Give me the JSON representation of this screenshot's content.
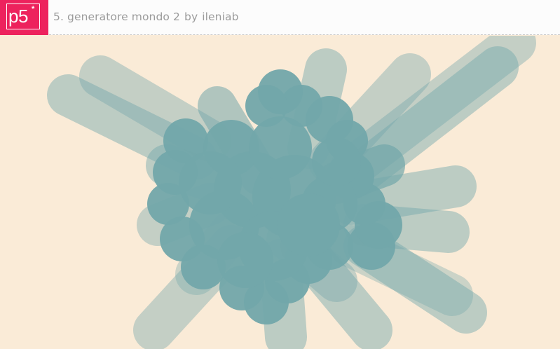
{
  "header": {
    "logo_text": "p5",
    "logo_star": "*",
    "sketch_title": "5. generatore mondo 2",
    "by_label": "by",
    "author": "ileniab"
  },
  "colors": {
    "brand": "#ed225d",
    "canvas_bg": "#faebd7",
    "blob": "#72a6aa",
    "header_bg": "#fcfcfc",
    "header_text": "#9b9b9b"
  },
  "canvas": {
    "description_icon": "p5-sketch-canvas"
  }
}
